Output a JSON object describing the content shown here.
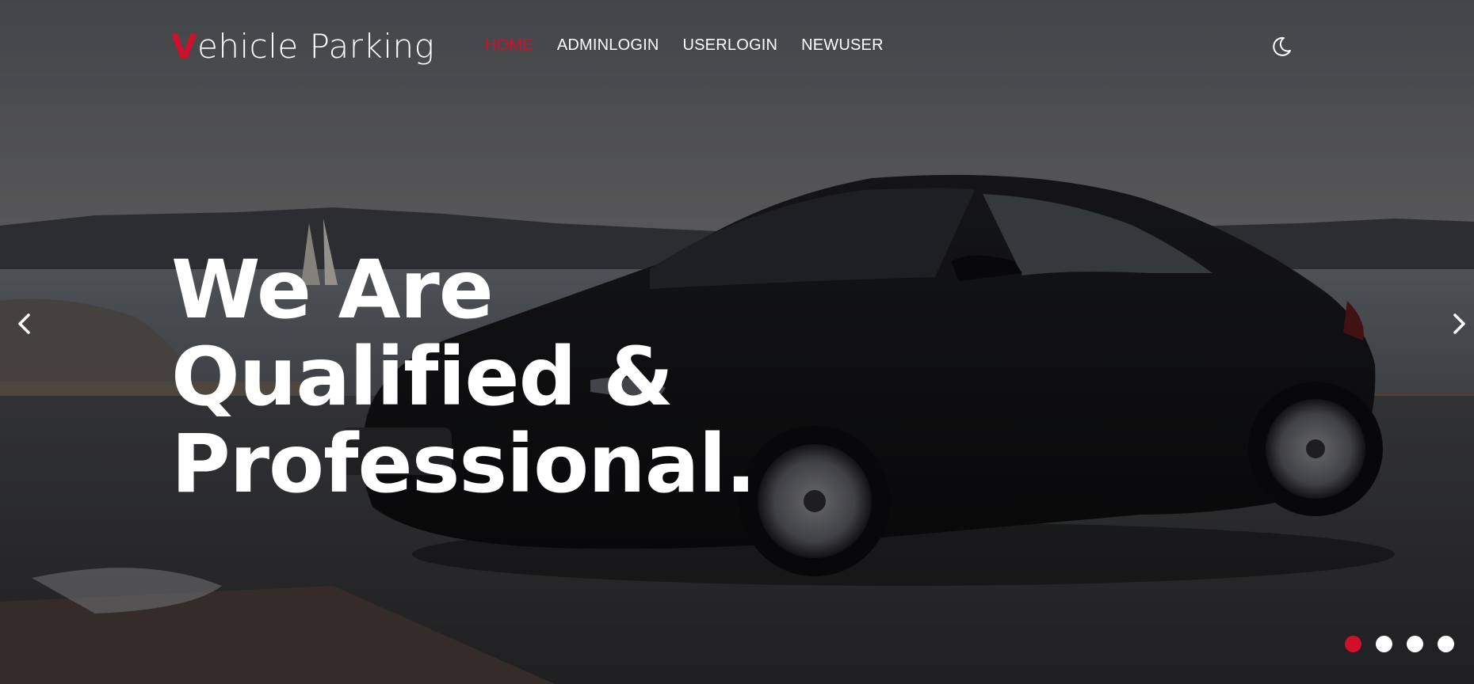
{
  "brand": {
    "first_letter": "V",
    "rest": "ehicle Parking"
  },
  "nav": {
    "items": [
      {
        "label": "HOME",
        "active": true
      },
      {
        "label": "ADMINLOGIN",
        "active": false
      },
      {
        "label": "USERLOGIN",
        "active": false
      },
      {
        "label": "NEWUSER",
        "active": false
      }
    ]
  },
  "theme_toggle": {
    "icon": "moon-icon"
  },
  "hero": {
    "headline_lines": [
      "We Are",
      "Qualified &",
      "Professional."
    ],
    "background": "car-photo"
  },
  "carousel": {
    "prev_icon": "chevron-left-icon",
    "next_icon": "chevron-right-icon",
    "slide_count": 4,
    "active_index": 0
  },
  "colors": {
    "accent": "#d0102b",
    "text": "#ffffff"
  }
}
